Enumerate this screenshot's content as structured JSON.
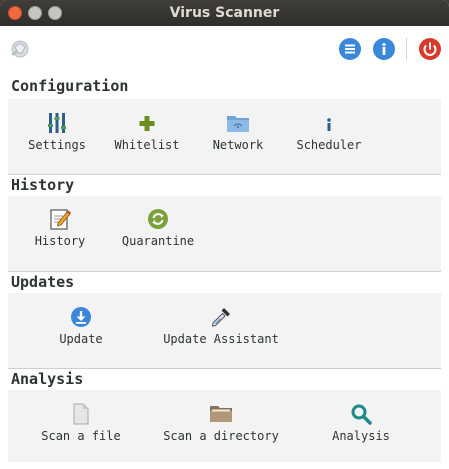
{
  "window": {
    "title": "Virus Scanner"
  },
  "toolbar": {
    "logo_icon": "scanner-logo-icon",
    "menu_icon": "menu-icon",
    "info_icon": "info-icon",
    "power_icon": "power-icon"
  },
  "sections": {
    "configuration": {
      "title": "Configuration",
      "items": [
        {
          "label": "Settings",
          "icon": "sliders-icon"
        },
        {
          "label": "Whitelist",
          "icon": "plus-icon"
        },
        {
          "label": "Network",
          "icon": "network-folder-icon"
        },
        {
          "label": "Scheduler",
          "icon": "info-small-icon"
        }
      ]
    },
    "history": {
      "title": "History",
      "items": [
        {
          "label": "History",
          "icon": "edit-document-icon"
        },
        {
          "label": "Quarantine",
          "icon": "refresh-icon"
        }
      ]
    },
    "updates": {
      "title": "Updates",
      "items": [
        {
          "label": "Update",
          "icon": "download-icon"
        },
        {
          "label": "Update Assistant",
          "icon": "dropper-icon"
        }
      ]
    },
    "analysis": {
      "title": "Analysis",
      "items": [
        {
          "label": "Scan a file",
          "icon": "file-icon"
        },
        {
          "label": "Scan a directory",
          "icon": "folder-icon"
        },
        {
          "label": "Analysis",
          "icon": "magnifier-icon"
        }
      ]
    }
  },
  "colors": {
    "accent_blue": "#3a86d8",
    "power_red": "#d8392b",
    "title_bar": "#2f2e2b",
    "section_bg": "#f3f3f3"
  }
}
